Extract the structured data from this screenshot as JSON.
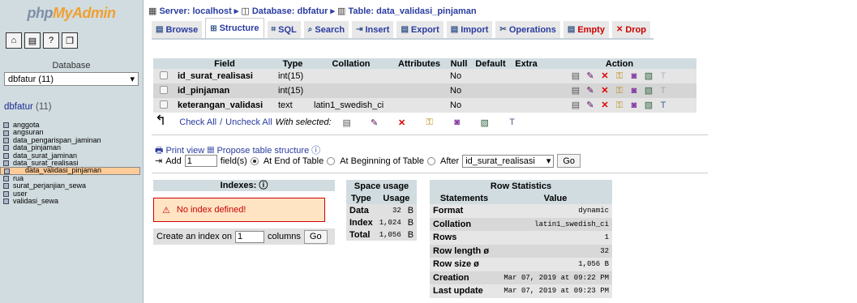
{
  "left": {
    "logo_php": "php",
    "logo_my": "MyAdmin",
    "quick_icons": [
      "home-icon",
      "sql-query-icon",
      "docs-icon",
      "copy-icon"
    ],
    "database_label": "Database",
    "database_select": "dbfatur (11)",
    "db_name": "dbfatur",
    "db_count": "(11)",
    "tables": [
      {
        "name": "anggota",
        "selected": false
      },
      {
        "name": "angsuran",
        "selected": false
      },
      {
        "name": "data_pengarispan_jaminan",
        "selected": false
      },
      {
        "name": "data_pinjaman",
        "selected": false
      },
      {
        "name": "data_surat_jaminan",
        "selected": false
      },
      {
        "name": "data_surat_realisasi",
        "selected": false
      },
      {
        "name": "data_validasi_pinjaman",
        "selected": true
      },
      {
        "name": "rua",
        "selected": false
      },
      {
        "name": "surat_perjanjian_sewa",
        "selected": false
      },
      {
        "name": "user",
        "selected": false
      },
      {
        "name": "validasi_sewa",
        "selected": false
      }
    ]
  },
  "breadcrumb": {
    "server": "Server: localhost",
    "database": "Database: dbfatur",
    "table": "Table: data_validasi_pinjaman"
  },
  "tabs": [
    "Browse",
    "Structure",
    "SQL",
    "Search",
    "Insert",
    "Export",
    "Import",
    "Operations",
    "Empty",
    "Drop"
  ],
  "fields_table": {
    "headers": [
      "Field",
      "Type",
      "Collation",
      "Attributes",
      "Null",
      "Default",
      "Extra",
      "Action"
    ],
    "rows": [
      {
        "field": "id_surat_realisasi",
        "type": "int(15)",
        "collation": "",
        "attributes": "",
        "null": "No",
        "default": "",
        "extra": ""
      },
      {
        "field": "id_pinjaman",
        "type": "int(15)",
        "collation": "",
        "attributes": "",
        "null": "No",
        "default": "",
        "extra": ""
      },
      {
        "field": "keterangan_validasi",
        "type": "text",
        "collation": "latin1_swedish_ci",
        "attributes": "",
        "null": "No",
        "default": "",
        "extra": ""
      }
    ]
  },
  "check_row": {
    "check_all": "Check All",
    "divider": " / ",
    "uncheck_all": "Uncheck All",
    "with_selected": "With selected:"
  },
  "print_view": "Print view",
  "propose": "Propose table structure",
  "add_row": {
    "add": "Add",
    "count": "1",
    "fields_label": "field(s)",
    "at_end": "At End of Table",
    "at_begin": "At Beginning of Table",
    "after": "After",
    "after_field": "id_surat_realisasi",
    "go": "Go"
  },
  "indexes": {
    "title": "Indexes:",
    "no_index": "No index defined!",
    "create_label": "Create an index on",
    "create_count": "1",
    "columns": "columns",
    "go": "Go"
  },
  "space_usage": {
    "title": "Space usage",
    "headers": [
      "Type",
      "Usage"
    ],
    "rows": [
      {
        "type": "Data",
        "value": "32",
        "unit": "B"
      },
      {
        "type": "Index",
        "value": "1,024",
        "unit": "B"
      },
      {
        "type": "Total",
        "value": "1,056",
        "unit": "B"
      }
    ]
  },
  "row_stats": {
    "title": "Row Statistics",
    "headers": [
      "Statements",
      "Value"
    ],
    "rows": [
      {
        "label": "Format",
        "value": "dynamic"
      },
      {
        "label": "Collation",
        "value": "latin1_swedish_ci"
      },
      {
        "label": "Rows",
        "value": "1"
      },
      {
        "label": "Row length ø",
        "value": "32"
      },
      {
        "label": "Row size ø",
        "value": "1,056 B"
      },
      {
        "label": "Creation",
        "value": "Mar 07, 2019 at 09:22 PM"
      },
      {
        "label": "Last update",
        "value": "Mar 07, 2019 at 09:23 PM"
      }
    ]
  }
}
